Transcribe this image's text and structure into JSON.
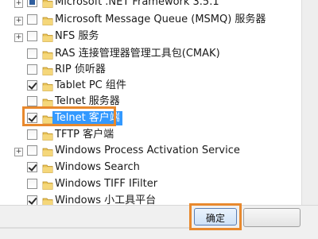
{
  "features": [
    {
      "label": "Microsoft .NET Framework 3.5.1",
      "expandable": true,
      "state": "partial"
    },
    {
      "label": "Microsoft Message Queue (MSMQ) 服务器",
      "expandable": true,
      "state": "unchecked"
    },
    {
      "label": "NFS 服务",
      "expandable": true,
      "state": "unchecked"
    },
    {
      "label": "RAS 连接管理器管理工具包(CMAK)",
      "expandable": false,
      "state": "unchecked"
    },
    {
      "label": "RIP 侦听器",
      "expandable": false,
      "state": "unchecked"
    },
    {
      "label": "Tablet PC 组件",
      "expandable": false,
      "state": "checked"
    },
    {
      "label": "Telnet 服务器",
      "expandable": false,
      "state": "unchecked"
    },
    {
      "label": "Telnet 客户端",
      "expandable": false,
      "state": "checked",
      "selected": true
    },
    {
      "label": "TFTP 客户端",
      "expandable": false,
      "state": "unchecked"
    },
    {
      "label": "Windows Process Activation Service",
      "expandable": true,
      "state": "unchecked"
    },
    {
      "label": "Windows Search",
      "expandable": false,
      "state": "checked"
    },
    {
      "label": "Windows TIFF IFilter",
      "expandable": false,
      "state": "unchecked"
    },
    {
      "label": "Windows 小工具平台",
      "expandable": false,
      "state": "checked"
    }
  ],
  "buttons": {
    "ok": "确定"
  },
  "colors": {
    "highlight": "#e8892e",
    "selection": "#3399ff"
  }
}
